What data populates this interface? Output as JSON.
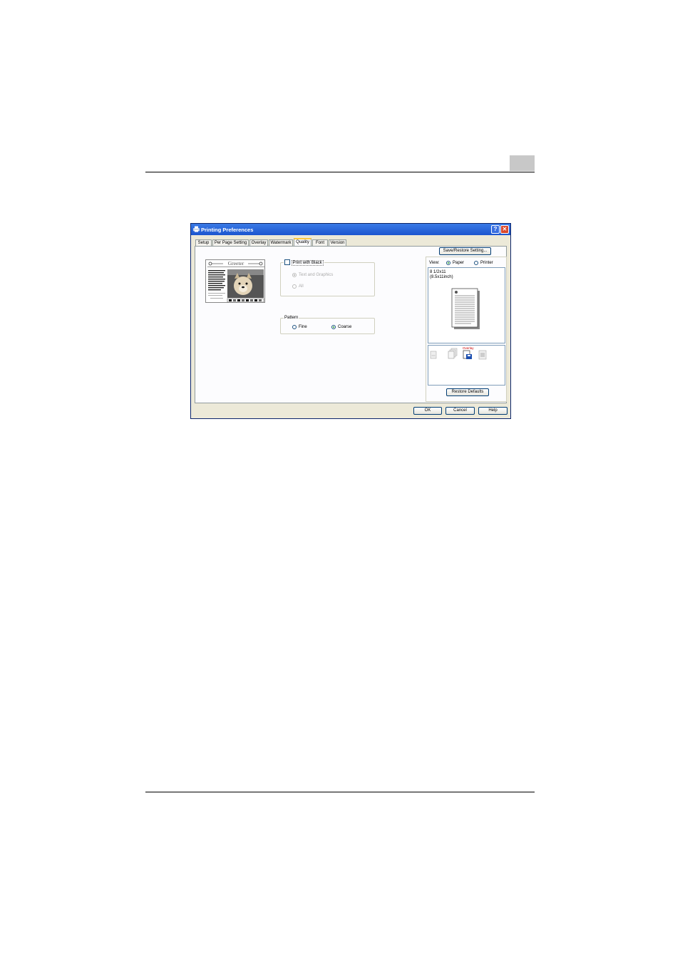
{
  "dialog": {
    "title": "Printing Preferences",
    "title_buttons": {
      "help": "?",
      "close": "✕"
    },
    "tabs": [
      "Setup",
      "Per Page Setting",
      "Overlay",
      "Watermark",
      "Quality",
      "Font",
      "Version"
    ],
    "active_tab": "Quality"
  },
  "sample_image": {
    "heading": "Greeter"
  },
  "print_with_black": {
    "label": "Print with Black",
    "checked": false,
    "options": [
      {
        "label": "Text and Graphics",
        "selected": true,
        "enabled": false
      },
      {
        "label": "All",
        "selected": false,
        "enabled": false
      }
    ]
  },
  "pattern": {
    "label": "Pattern",
    "options": [
      {
        "label": "Fine",
        "selected": false
      },
      {
        "label": "Coarse",
        "selected": true
      }
    ]
  },
  "save_restore_button": "Save/Restore Setting...",
  "view": {
    "label": "View:",
    "options": [
      {
        "label": "Paper",
        "selected": true
      },
      {
        "label": "Printer",
        "selected": false
      }
    ],
    "paper_size_line1": "8 1/2x11",
    "paper_size_line2": "(8.5x11inch)"
  },
  "overlay_icon_label": "Overlay",
  "restore_defaults_button": "Restore Defaults",
  "footer_buttons": {
    "ok": "OK",
    "cancel": "Cancel",
    "help": "Help"
  },
  "colors": {
    "titlebar": "#1b55cf",
    "dialog_bg": "#ece9d8",
    "close": "#d9482c",
    "active_tab": "#ffc83c"
  }
}
